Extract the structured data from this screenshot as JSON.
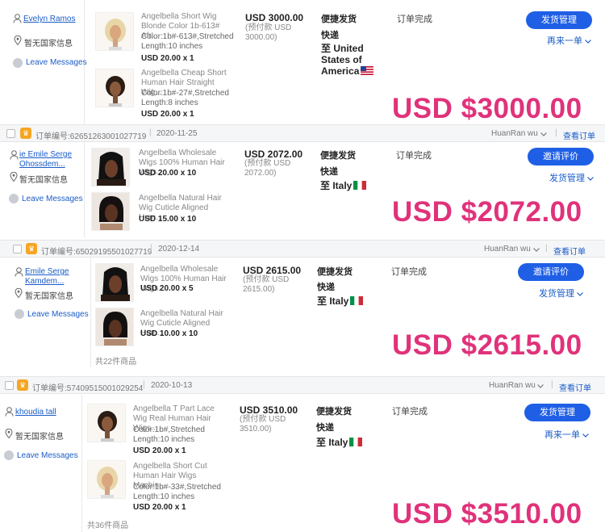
{
  "orders": [
    {
      "buyer": {
        "name": "Evelyn Ramos",
        "country": "暂无国家信息",
        "message": "Leave Messages"
      },
      "items": [
        {
          "name": "Angelbella Short Wig Blonde Color 1b-613# Afr...",
          "attr": "Color:1b#-613#,Stretched Length:10 inches",
          "price": "USD 20.00 x 1"
        },
        {
          "name": "Angelbella Cheap Short Human Hair Straight Wig...",
          "attr": "Color:1b#-27#,Stretched Length:8 inches",
          "price": "USD 20.00 x 1"
        }
      ],
      "amount": "USD 3000.00",
      "prepay": "(预付款 USD 3000.00)",
      "shipping": "便捷发货",
      "express": "快递",
      "dest": "至 United States of America",
      "status": "订单完成",
      "button": "发货管理",
      "link": "再来一单",
      "overlay": "USD $3000.00"
    },
    {
      "header": {
        "order_no": "订单编号:62651263001027719",
        "date": "2020-11-25",
        "seller": "HuanRan wu",
        "view": "查看订单"
      },
      "buyer": {
        "name": "ie Emile Serge Ohossdem...",
        "country": "暂无国家信息",
        "message": "Leave Messages"
      },
      "items": [
        {
          "name": "Angelbella Wholesale Wigs 100% Human Hair Wigs...",
          "attr": "",
          "price": "USD 20.00 x 10"
        },
        {
          "name": "Angelbella Natural Hair Wig Cuticle Aligned Hum...",
          "attr": "",
          "price": "USD 15.00 x 10"
        }
      ],
      "amount": "USD 2072.00",
      "prepay": "(预付款 USD 2072.00)",
      "shipping": "便捷发货",
      "express": "快递",
      "dest": "至 Italy",
      "status": "订单完成",
      "button": "邀请评价",
      "link": "发货管理",
      "overlay": "USD $2072.00"
    },
    {
      "header": {
        "order_no": "订单编号:65029195501027719",
        "date": "2020-12-14",
        "seller": "HuanRan wu",
        "view": "查看订单"
      },
      "buyer": {
        "name": "Emile Serge Kamdem...",
        "country": "暂无国家信息",
        "message": "Leave Messages"
      },
      "items": [
        {
          "name": "Angelbella Wholesale Wigs 100% Human Hair Wigs...",
          "attr": "",
          "price": "USD 20.00 x 5"
        },
        {
          "name": "Angelbella Natural Hair Wig Cuticle Aligned Hum...",
          "attr": "",
          "price": "USD 10.00 x 10"
        }
      ],
      "total": "共22件商品",
      "amount": "USD 2615.00",
      "prepay": "(预付款 USD 2615.00)",
      "shipping": "便捷发货",
      "express": "快递",
      "dest": "至 Italy",
      "status": "订单完成",
      "button": "邀请评价",
      "link": "发货管理",
      "overlay": "USD $2615.00"
    },
    {
      "header": {
        "order_no": "订单编号:57409515001029254",
        "date": "2020-10-13",
        "seller": "HuanRan wu",
        "view": "查看订单"
      },
      "buyer": {
        "name": "khoudia tall",
        "country": "暂无国家信息",
        "message": "Leave Messages"
      },
      "items": [
        {
          "name": "Angelbella T Part Lace Wig Real Human Hair Wigs...",
          "attr": "Color:1b#,Stretched Length:10 inches",
          "price": "USD 20.00 x 1"
        },
        {
          "name": "Angelbella Short Cut Human Hair Wigs Machin...",
          "attr": "Color:1b#-33#,Stretched Length:10 inches",
          "price": "USD 20.00 x 1"
        }
      ],
      "total": "共36件商品",
      "amount": "USD 3510.00",
      "prepay": "(预付款 USD 3510.00)",
      "shipping": "便捷发货",
      "express": "快递",
      "dest": "至 Italy",
      "status": "订单完成",
      "button": "发货管理",
      "link": "再来一单",
      "overlay": "USD $3510.00"
    }
  ],
  "colors": {
    "accent": "#1f5fe6",
    "overlay": "#e0327a",
    "link": "#1a5cc8"
  }
}
